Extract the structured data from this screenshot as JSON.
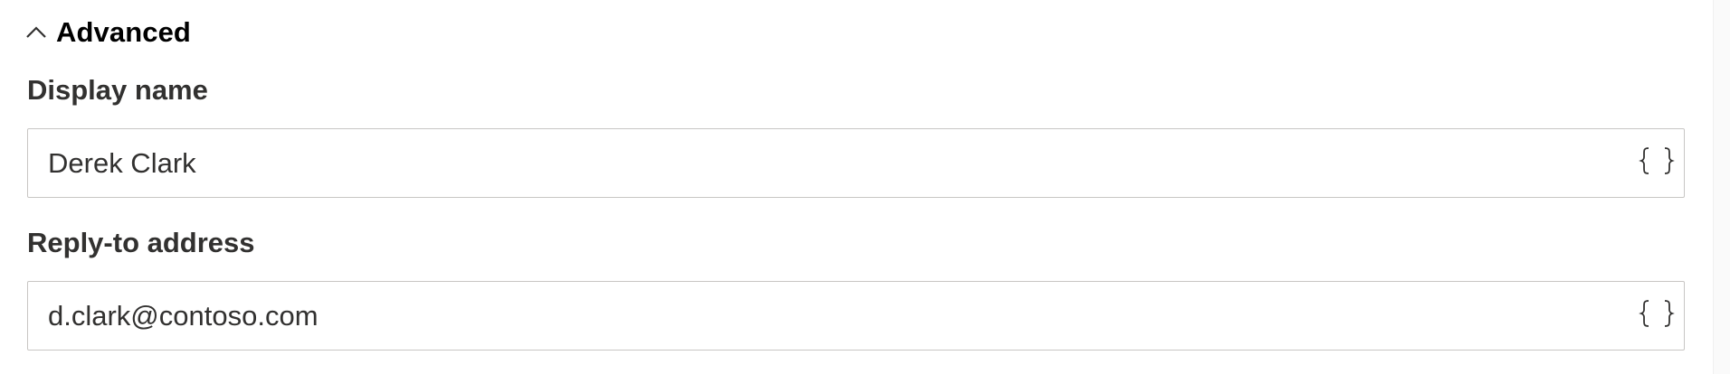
{
  "section": {
    "title": "Advanced",
    "expanded": true,
    "icon": "chevron-up-icon"
  },
  "fields": [
    {
      "label": "Display name",
      "value": "Derek Clark",
      "icon": "braces-icon"
    },
    {
      "label": "Reply-to address",
      "value": "d.clark@contoso.com",
      "icon": "braces-icon"
    }
  ]
}
